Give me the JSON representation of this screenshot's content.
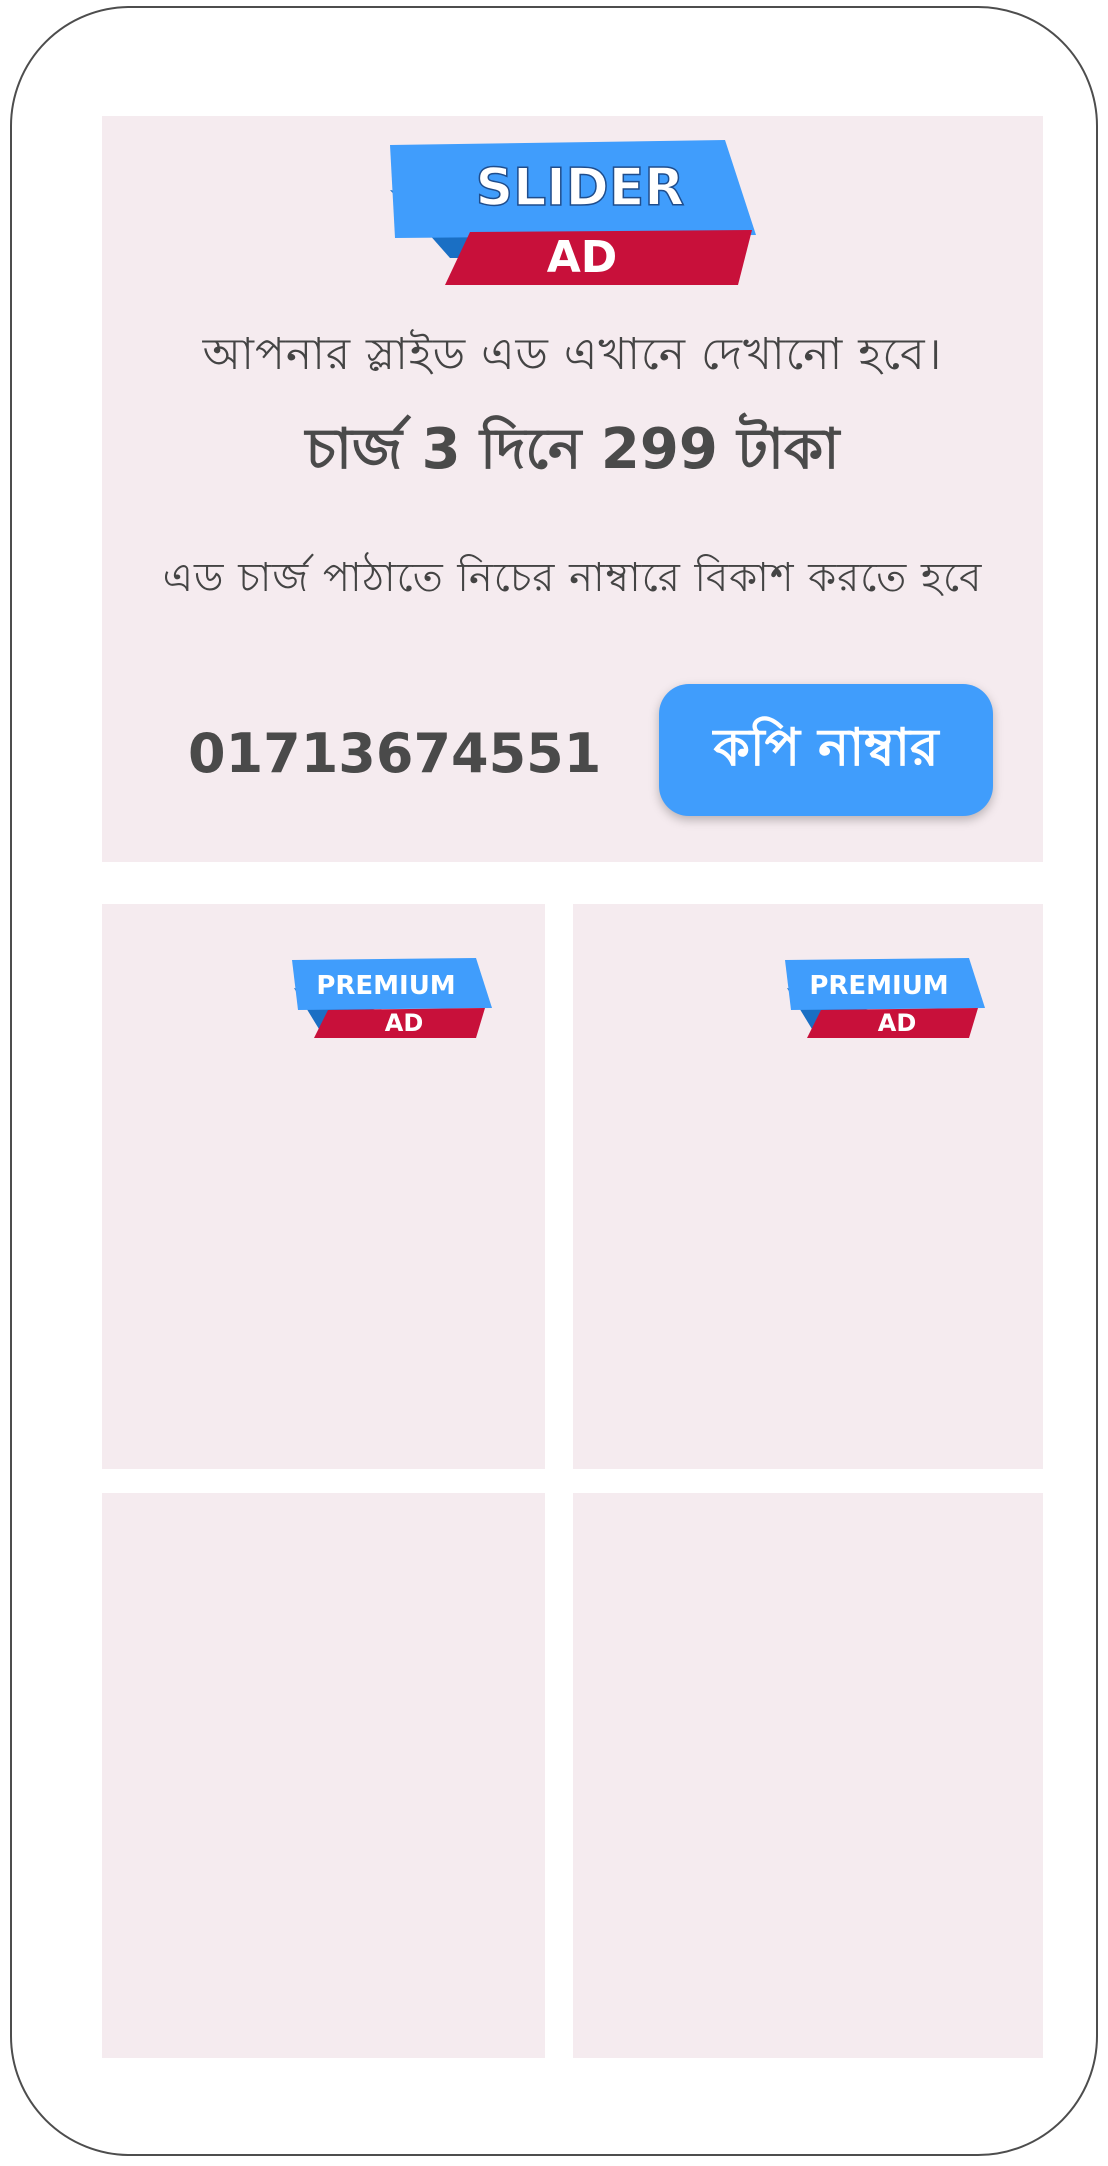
{
  "slider_ad": {
    "badge": {
      "top_text": "SLIDER",
      "bottom_text": "AD"
    },
    "line1": "আপনার স্লাইড এড এখানে দেখানো হবে।",
    "line2": "চার্জ 3 দিনে 299 টাকা",
    "line3": "এড চার্জ পাঠাতে নিচের নাম্বারে বিকাশ করতে হবে",
    "phone_number": "01713674551",
    "copy_button_label": "কপি নাম্বার"
  },
  "premium_badge": {
    "top_text": "PREMIUM",
    "bottom_text": "AD"
  },
  "colors": {
    "badge_blue": "#409dfc",
    "badge_dark_blue": "#1a6fc4",
    "badge_red": "#c8103a",
    "card_background": "#f5ebef",
    "text_dark": "#444444"
  }
}
